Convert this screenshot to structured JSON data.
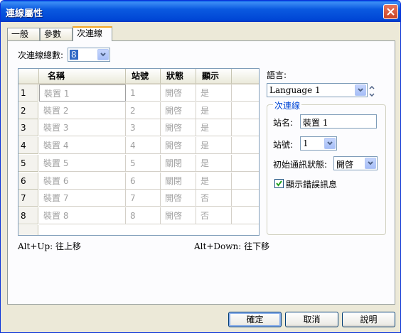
{
  "window": {
    "title": "連線屬性",
    "close_label": "×"
  },
  "tabs": [
    {
      "label": "一般"
    },
    {
      "label": "參數"
    },
    {
      "label": "次連線"
    }
  ],
  "count": {
    "label": "次連線總數:",
    "value": "8"
  },
  "grid": {
    "columns": [
      "名稱",
      "站號",
      "狀態",
      "顯示"
    ],
    "rows": [
      {
        "index": "1",
        "name": "裝置 1",
        "station": "1",
        "state": "開啓",
        "show": "是"
      },
      {
        "index": "2",
        "name": "裝置 2",
        "station": "2",
        "state": "開啓",
        "show": "是"
      },
      {
        "index": "3",
        "name": "裝置 3",
        "station": "3",
        "state": "開啓",
        "show": "是"
      },
      {
        "index": "4",
        "name": "裝置 4",
        "station": "4",
        "state": "開啓",
        "show": "是"
      },
      {
        "index": "5",
        "name": "裝置 5",
        "station": "5",
        "state": "關閉",
        "show": "是"
      },
      {
        "index": "6",
        "name": "裝置 6",
        "station": "6",
        "state": "關閉",
        "show": "是"
      },
      {
        "index": "7",
        "name": "裝置 7",
        "station": "7",
        "state": "開啓",
        "show": "否"
      },
      {
        "index": "8",
        "name": "裝置 8",
        "station": "8",
        "state": "開啓",
        "show": "否"
      }
    ]
  },
  "language": {
    "label": "語言:",
    "value": "Language 1"
  },
  "subconn": {
    "group_title": "次連線",
    "name_label": "站名:",
    "name_value": "裝置 1",
    "station_label": "站號:",
    "station_value": "1",
    "init_label": "初始通訊狀態:",
    "init_value": "開啓",
    "show_error_label": "顯示錯誤訊息",
    "show_error_checked": true
  },
  "hints": {
    "up": "Alt+Up: 往上移",
    "down": "Alt+Down: 往下移"
  },
  "buttons": {
    "ok": "確定",
    "cancel": "取消",
    "help": "說明"
  }
}
